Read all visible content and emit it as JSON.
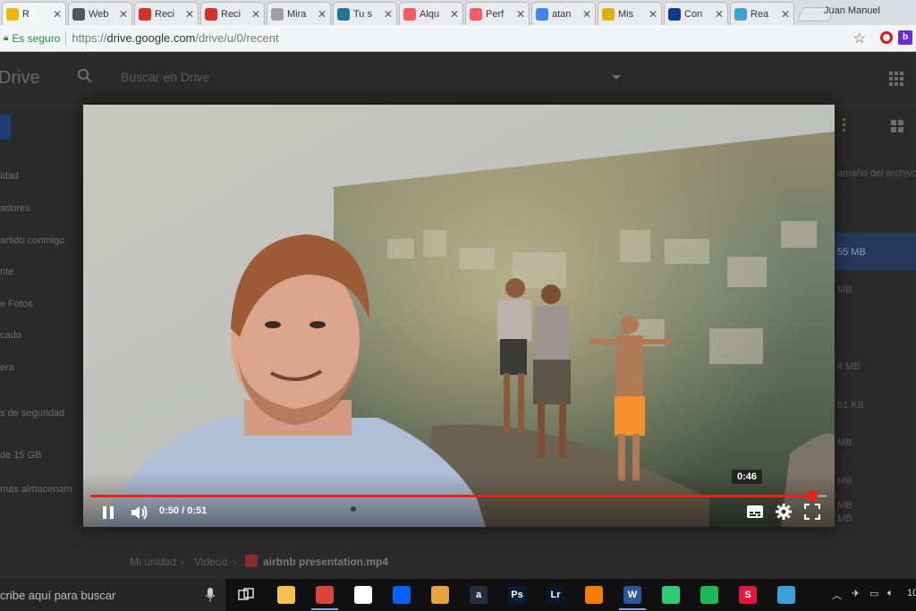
{
  "browser": {
    "tabs": [
      {
        "label": "R",
        "icon": "google-drive-icon",
        "color": "#f4b400",
        "active": true
      },
      {
        "label": "Web",
        "icon": "invision-icon",
        "color": "#555555"
      },
      {
        "label": "Reci",
        "icon": "gmail-icon",
        "color": "#d93025"
      },
      {
        "label": "Reci",
        "icon": "gmail-icon",
        "color": "#d93025"
      },
      {
        "label": "Mira",
        "icon": "document-icon",
        "color": "#9e9e9e"
      },
      {
        "label": "Tu s",
        "icon": "wordpress-icon",
        "color": "#21759b"
      },
      {
        "label": "Alqu",
        "icon": "airbnb-icon",
        "color": "#ff5a5f"
      },
      {
        "label": "Perf",
        "icon": "airbnb-icon",
        "color": "#ff5a5f"
      },
      {
        "label": "atan",
        "icon": "google-icon",
        "color": "#4285f4"
      },
      {
        "label": "Mis",
        "icon": "euro-icon",
        "color": "#e2b100"
      },
      {
        "label": "Con",
        "icon": "paypal-icon",
        "color": "#0a3d91"
      },
      {
        "label": "Rea",
        "icon": "react-icon",
        "color": "#3ba3d6"
      }
    ],
    "user_name": "Juan Manuel",
    "secure_label": "Es seguro",
    "url_prefix": "https://",
    "url_host": "drive.google.com",
    "url_path": "/drive/u/0/recent",
    "opera_ext_icon": "opera-icon",
    "ext_b_label": "b"
  },
  "drive": {
    "title": "Drive",
    "search_placeholder": "Buscar en Drive",
    "sidebar": [
      "idad",
      "adores",
      "artido conmigo",
      "nte",
      "e Fotos",
      "cado",
      "era",
      "s de seguridad",
      "de 15 GB",
      "más almacenam"
    ],
    "right_column_header": "amaño del archivo",
    "right_column_values": [
      "55 MB",
      "MB",
      "4 MB",
      "61 KB",
      "MB",
      "MB",
      "MB",
      "MB"
    ],
    "breadcrumb": {
      "root": "Mi unidad",
      "folder": "Videod",
      "file": "airbnb presentation.mp4"
    }
  },
  "player": {
    "current_time": "0:50",
    "duration": "0:51",
    "time_separator": " / ",
    "hover_time": "0:46",
    "progress_fraction": 0.98,
    "accent_color": "#e62117"
  },
  "taskbar": {
    "search_text": "cribe aquí para buscar",
    "pinned": [
      {
        "icon": "file-explorer-icon",
        "label": "",
        "color": "#f2c14e"
      },
      {
        "icon": "chrome-icon",
        "label": "",
        "color": "#db4437"
      },
      {
        "icon": "store-icon",
        "label": "",
        "color": "#ffffff"
      },
      {
        "icon": "dropbox-icon",
        "label": "",
        "color": "#0061ff"
      },
      {
        "icon": "eye-icon",
        "label": "",
        "color": "#e8a33d"
      },
      {
        "icon": "amazon-icon",
        "label": "a",
        "color": "#232f3e"
      },
      {
        "icon": "photoshop-icon",
        "label": "Ps",
        "color": "#001e36"
      },
      {
        "icon": "lightroom-icon",
        "label": "Lr",
        "color": "#001a2b"
      },
      {
        "icon": "analytics-icon",
        "label": "",
        "color": "#f57c00"
      },
      {
        "icon": "word-icon",
        "label": "W",
        "color": "#2b579a"
      },
      {
        "icon": "globe-icon",
        "label": "",
        "color": "#2ecc71"
      },
      {
        "icon": "spotify-icon",
        "label": "",
        "color": "#1db954"
      },
      {
        "icon": "s-app-icon",
        "label": "S",
        "color": "#e1173b"
      },
      {
        "icon": "dots-app-icon",
        "label": "",
        "color": "#3aa0d8"
      }
    ],
    "clock_fragment": "10"
  }
}
